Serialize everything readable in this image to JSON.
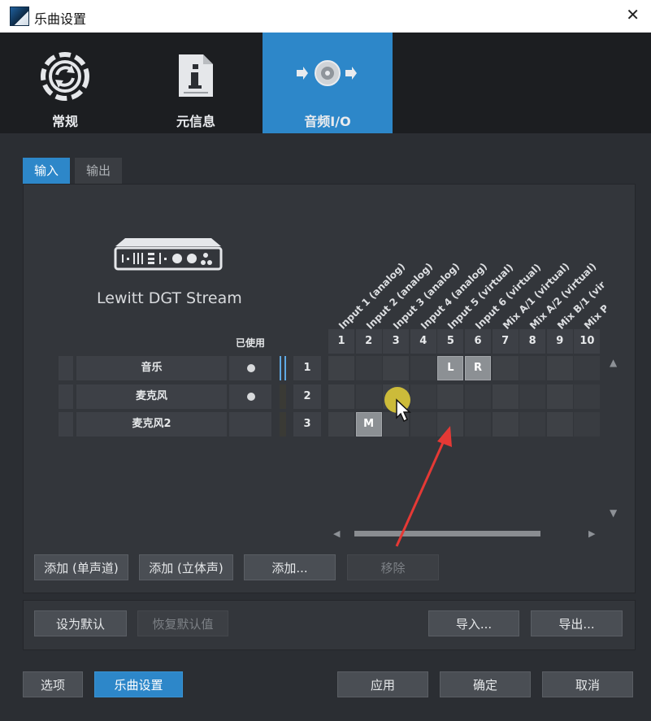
{
  "window": {
    "title": "乐曲设置",
    "close_glyph": "✕"
  },
  "categories": [
    {
      "label": "常规",
      "icon": "sync-icon",
      "active": false
    },
    {
      "label": "元信息",
      "icon": "info-document-icon",
      "active": false
    },
    {
      "label": "音频I/O",
      "icon": "audio-io-icon",
      "active": true
    }
  ],
  "io_tabs": {
    "input": "输入",
    "output": "输出"
  },
  "device": {
    "name": "Lewitt DGT Stream",
    "icon": "audio-interface-icon"
  },
  "channels": {
    "used_header": "已使用",
    "rows": [
      {
        "name": "音乐",
        "used": true,
        "number": "1"
      },
      {
        "name": "麦克风",
        "used": true,
        "number": "2"
      },
      {
        "name": "麦克风2",
        "used": false,
        "number": "3"
      }
    ]
  },
  "inputs": {
    "headers": [
      "Input 1 (analog)",
      "Input 2 (analog)",
      "Input 3 (analog)",
      "Input 4 (analog)",
      "Input 5 (virtual)",
      "Input 6 (virtual)",
      "Mix A/1 (virtual)",
      "Mix A/2 (virtual)",
      "Mix B/1 (vir",
      "Mix P"
    ],
    "numbers": [
      "1",
      "2",
      "3",
      "4",
      "5",
      "6",
      "7",
      "8",
      "9",
      "10"
    ],
    "assignments": [
      {
        "row": 0,
        "col": 4,
        "label": "L"
      },
      {
        "row": 0,
        "col": 5,
        "label": "R"
      },
      {
        "row": 2,
        "col": 1,
        "label": "M"
      }
    ]
  },
  "scroll": {
    "up": "▲",
    "down": "▼",
    "left": "◀",
    "right": "▶"
  },
  "buttons": {
    "add_mono": "添加 (单声道)",
    "add_stereo": "添加 (立体声)",
    "add": "添加...",
    "remove": "移除",
    "set_default": "设为默认",
    "restore_default": "恢复默认值",
    "import": "导入...",
    "export": "导出...",
    "options": "选项",
    "song_settings": "乐曲设置",
    "apply": "应用",
    "ok": "确定",
    "cancel": "取消"
  },
  "colors": {
    "accent": "#2d87c9",
    "panel": "#33363b",
    "background": "#2b2e33",
    "annotation": "#e53935",
    "cursor_highlight": "#d8c53a"
  }
}
